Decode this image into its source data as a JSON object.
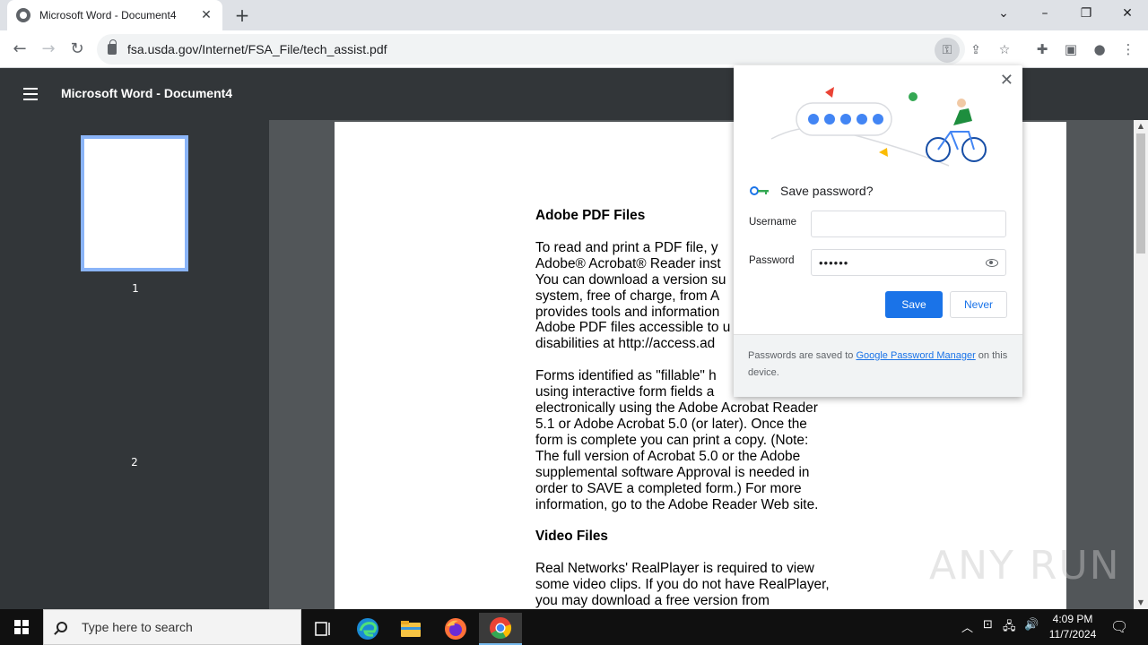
{
  "browser": {
    "tab_title": "Microsoft Word - Document4",
    "url": "fsa.usda.gov/Internet/FSA_File/tech_assist.pdf"
  },
  "pdf": {
    "title": "Microsoft Word - Document4",
    "thumbnails": [
      "1",
      "2"
    ],
    "doc": {
      "heading1": "Adobe PDF Files",
      "para1": "To read and print a PDF file, y\nAdobe® Acrobat® Reader inst\nYou can download a version su\nsystem, free of charge, from A\nprovides tools and information\nAdobe PDF files accessible to u\ndisabilities at http://access.ad",
      "para2": "Forms identified as \"fillable\" h\nusing interactive form fields a\nelectronically using the Adobe Acrobat Reader\n5.1 or Adobe Acrobat 5.0 (or later). Once the\nform is complete you can print a copy. (Note:\nThe full version of Acrobat 5.0 or the Adobe\nsupplemental software Approval is needed in\norder to SAVE a completed form.) For more\ninformation, go to the Adobe Reader Web site.",
      "heading2": "Video Files",
      "para3": "Real Networks' RealPlayer is required to view\nsome video clips. If you do not have RealPlayer,\nyou may download a free version from"
    }
  },
  "popup": {
    "title": "Save password?",
    "username_label": "Username",
    "username_value": "",
    "password_label": "Password",
    "password_value": "••••••",
    "save_label": "Save",
    "never_label": "Never",
    "footer_prefix": "Passwords are saved to ",
    "footer_link": "Google Password Manager",
    "footer_suffix": " on this device."
  },
  "watermark": "ANY RUN",
  "taskbar": {
    "search_placeholder": "Type here to search",
    "time": "4:09 PM",
    "date": "11/7/2024"
  },
  "colors": {
    "accent": "#1a73e8",
    "viewer_bg": "#525659",
    "header_bg": "#323639"
  }
}
